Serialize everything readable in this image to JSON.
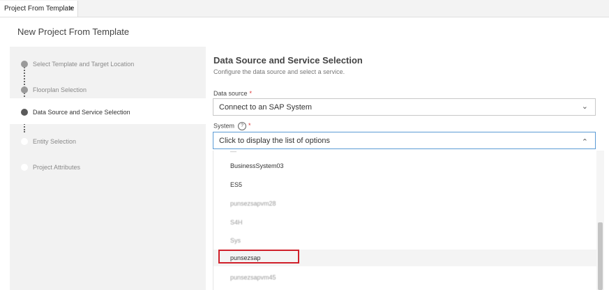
{
  "tab": {
    "label": "Project From Template",
    "close": "×"
  },
  "page": {
    "title": "New Project From Template"
  },
  "steps": [
    {
      "label": "Select Template and Target Location"
    },
    {
      "label": "Floorplan Selection"
    },
    {
      "label": "Data Source and Service Selection"
    },
    {
      "label": "Entity Selection"
    },
    {
      "label": "Project Attributes"
    }
  ],
  "section": {
    "title": "Data Source and Service Selection",
    "subtitle": "Configure the data source and select a service."
  },
  "data_source": {
    "label": "Data source",
    "required": "*",
    "value": "Connect to an SAP System",
    "chevron": "⌄"
  },
  "system": {
    "label": "System",
    "help": "?",
    "required": "*",
    "placeholder": "Click to display the list of options",
    "chevron": "⌃"
  },
  "options": [
    {
      "label": "BusinessSystem03"
    },
    {
      "label": "ES5"
    },
    {
      "label": "punsezsapvm28"
    },
    {
      "label": "S4H"
    },
    {
      "label": "Sys"
    },
    {
      "label": "punsezsap"
    },
    {
      "label": "punsezsapvm45"
    }
  ],
  "colors": {
    "highlight": "#d0202a",
    "accent": "#5b9bd5"
  }
}
